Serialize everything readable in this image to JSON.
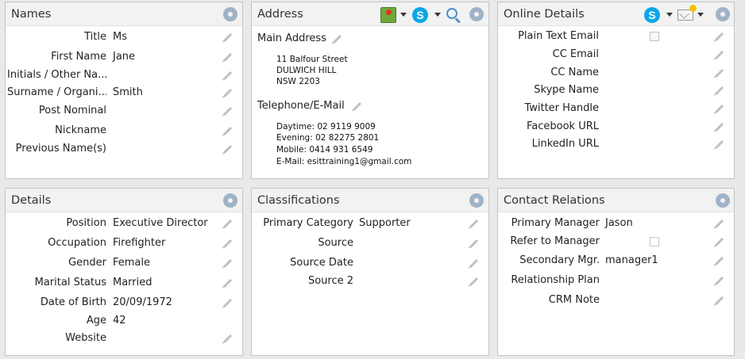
{
  "names": {
    "title": "Names",
    "rows": [
      {
        "label": "Title",
        "value": "Ms"
      },
      {
        "label": "First Name",
        "value": "Jane"
      },
      {
        "label": "Initials / Other Na...",
        "value": ""
      },
      {
        "label": "Surname / Organi...",
        "value": "Smith"
      },
      {
        "label": "Post Nominal",
        "value": ""
      },
      {
        "label": "Nickname",
        "value": ""
      },
      {
        "label": "Previous Name(s)",
        "value": ""
      }
    ]
  },
  "address": {
    "title": "Address",
    "main_heading": "Main Address",
    "main_lines": [
      "11 Balfour Street",
      "DULWICH HILL",
      "NSW 2203"
    ],
    "tel_heading": "Telephone/E-Mail",
    "tel_lines": [
      "Daytime: 02 9119 9009",
      "Evening: 02 82275 2801",
      "Mobile: 0414 931 6549",
      "E-Mail: esittraining1@gmail.com"
    ]
  },
  "online": {
    "title": "Online Details",
    "rows": [
      {
        "label": "Plain Text Email",
        "value": "",
        "checkbox": true
      },
      {
        "label": "CC Email",
        "value": ""
      },
      {
        "label": "CC Name",
        "value": ""
      },
      {
        "label": "Skype Name",
        "value": ""
      },
      {
        "label": "Twitter Handle",
        "value": ""
      },
      {
        "label": "Facebook URL",
        "value": ""
      },
      {
        "label": "LinkedIn URL",
        "value": ""
      }
    ]
  },
  "details": {
    "title": "Details",
    "rows": [
      {
        "label": "Position",
        "value": "Executive Director"
      },
      {
        "label": "Occupation",
        "value": "Firefighter"
      },
      {
        "label": "Gender",
        "value": "Female"
      },
      {
        "label": "Marital Status",
        "value": "Married"
      },
      {
        "label": "Date of Birth",
        "value": "20/09/1972"
      },
      {
        "label": "Age",
        "value": "42"
      },
      {
        "label": "Website",
        "value": ""
      }
    ]
  },
  "classifications": {
    "title": "Classifications",
    "rows": [
      {
        "label": "Primary  Category",
        "value": "Supporter"
      },
      {
        "label": "Source",
        "value": ""
      },
      {
        "label": "Source Date",
        "value": ""
      },
      {
        "label": "Source 2",
        "value": ""
      }
    ]
  },
  "relations": {
    "title": "Contact Relations",
    "rows": [
      {
        "label": "Primary Manager",
        "value": "Jason"
      },
      {
        "label": "Refer to Manager",
        "value": "",
        "checkbox": true
      },
      {
        "label": "Secondary Mgr.",
        "value": "manager1"
      },
      {
        "label": "Relationship Plan",
        "value": ""
      },
      {
        "label": "CRM Note",
        "value": ""
      }
    ]
  },
  "icons": {
    "settings": "gear-icon",
    "skype": "skype-icon",
    "skype_glyph": "S",
    "map": "map-icon",
    "search": "search-icon",
    "mail": "new-mail-icon",
    "edit": "pencil-icon"
  },
  "colors": {
    "gear": "#9fb3c6",
    "skype": "#0aa7e6",
    "header_bg": "#f2f2f2"
  }
}
